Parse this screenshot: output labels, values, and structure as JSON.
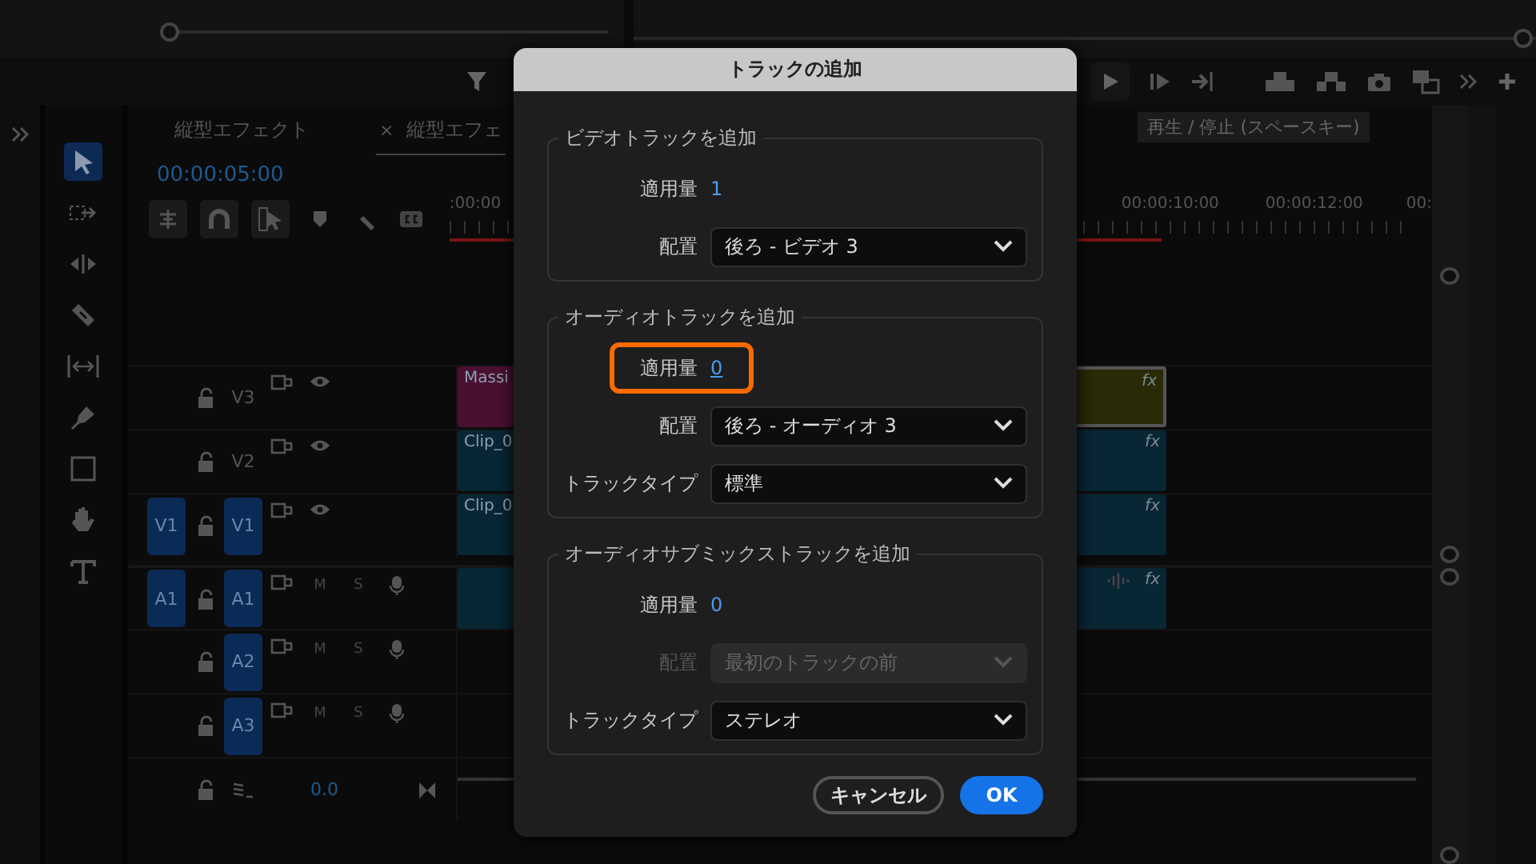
{
  "toolbar": {
    "transport": [
      {
        "kind": "play"
      },
      {
        "kind": "step"
      },
      {
        "kind": "goto"
      },
      {
        "kind": "lift"
      },
      {
        "kind": "extract"
      },
      {
        "kind": "camera"
      },
      {
        "kind": "compare"
      },
      {
        "kind": "more"
      },
      {
        "kind": "add"
      }
    ],
    "tooltip": "再生 / 停止 (スペースキー)"
  },
  "tools": [
    {
      "kind": "select",
      "selected": true
    },
    {
      "kind": "track-select",
      "selected": false
    },
    {
      "kind": "ripple",
      "selected": false
    },
    {
      "kind": "razor",
      "selected": false
    },
    {
      "kind": "slip",
      "selected": false
    },
    {
      "kind": "pen",
      "selected": false
    },
    {
      "kind": "rect",
      "selected": false
    },
    {
      "kind": "hand",
      "selected": false
    },
    {
      "kind": "type",
      "selected": false
    }
  ],
  "timeline": {
    "tabs": [
      {
        "label": "縦型エフェクト",
        "selected": false
      },
      {
        "label": "縦型エフェ",
        "close": "×",
        "selected": true
      }
    ],
    "timecode": "00:00:05:00",
    "ruler_labels": [
      ":00:00",
      "00:00:10:00",
      "00:00:12:00",
      "00:"
    ],
    "tracks": [
      {
        "kind": "video",
        "name": "V3",
        "targeted": false,
        "clips": [
          {
            "name": "Massi",
            "color": "#4a1030",
            "selected": false
          },
          {
            "color": "#2a2a06",
            "selected": true,
            "fx": "fx"
          }
        ]
      },
      {
        "kind": "video",
        "name": "V2",
        "targeted": false,
        "clips": [
          {
            "name": "Clip_0",
            "color": "#082634",
            "selected": false,
            "fx": "fx"
          }
        ]
      },
      {
        "kind": "video",
        "name": "V1",
        "source": "V1",
        "targeted": true,
        "clips": [
          {
            "name": "Clip_0",
            "color": "#082634",
            "selected": false,
            "fx": "fx"
          }
        ]
      },
      {
        "kind": "audio",
        "name": "A1",
        "source": "A1",
        "targeted": true,
        "mute": "M",
        "solo": "S",
        "clips": [
          {
            "color": "#082634",
            "selected": false,
            "fx": "fx"
          }
        ]
      },
      {
        "kind": "audio",
        "name": "A2",
        "targeted": true,
        "mute": "M",
        "solo": "S"
      },
      {
        "kind": "audio",
        "name": "A3",
        "targeted": true,
        "mute": "M",
        "solo": "S"
      },
      {
        "kind": "mix",
        "value": "0.0"
      }
    ]
  },
  "dialog": {
    "title": "トラックの追加",
    "sections": [
      {
        "title": "ビデオトラックを追加",
        "rows": [
          {
            "kind": "amount",
            "label": "適用量",
            "value": "1",
            "highlighted": false
          },
          {
            "kind": "select",
            "label": "配置",
            "value": "後ろ - ビデオ 3",
            "disabled": false
          }
        ]
      },
      {
        "title": "オーディオトラックを追加",
        "rows": [
          {
            "kind": "amount",
            "label": "適用量",
            "value": "0",
            "highlighted": true
          },
          {
            "kind": "select",
            "label": "配置",
            "value": "後ろ - オーディオ 3",
            "disabled": false
          },
          {
            "kind": "select",
            "label": "トラックタイプ",
            "value": "標準",
            "disabled": false
          }
        ]
      },
      {
        "title": "オーディオサブミックストラックを追加",
        "rows": [
          {
            "kind": "amount",
            "label": "適用量",
            "value": "0",
            "highlighted": false
          },
          {
            "kind": "select",
            "label": "配置",
            "value": "最初のトラックの前",
            "disabled": true
          },
          {
            "kind": "select",
            "label": "トラックタイプ",
            "value": "ステレオ",
            "disabled": false
          }
        ]
      }
    ],
    "buttons": [
      {
        "label": "キャンセル",
        "kind": "secondary"
      },
      {
        "label": "OK",
        "kind": "primary"
      }
    ]
  }
}
